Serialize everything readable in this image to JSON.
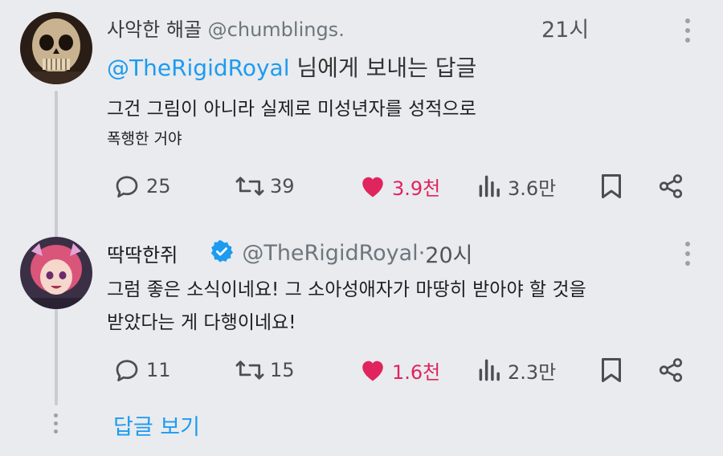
{
  "tweet1": {
    "display_name": "사악한 해골",
    "handle": "@chumblings.",
    "time": "21시",
    "reply_prefix": "@TheRigidRoyal",
    "reply_suffix": " 님에게 보내는 답글",
    "text_line1": "그건 그림이 아니라 실제로 미성년자를 성적으로",
    "text_line2": "폭행한 거야",
    "replies": "25",
    "retweets": "39",
    "likes": "3.9천",
    "views": "3.6만"
  },
  "tweet2": {
    "display_name": "딱딱한쥐",
    "handle": "@TheRigidRoyal",
    "separator": " · ",
    "time": "20시",
    "text_line1": "그럼 좋은 소식이네요! 그 소아성애자가 마땅히 받아야 할 것을",
    "text_line2": "받았다는 게 다행이네요!",
    "replies": "11",
    "retweets": "15",
    "likes": "1.6천",
    "views": "2.3만"
  },
  "show_replies_label": "답글 보기",
  "icons": {
    "reply": "reply-icon",
    "retweet": "retweet-icon",
    "like": "heart-icon",
    "views": "views-icon",
    "bookmark": "bookmark-icon",
    "share": "share-icon",
    "more": "more-icon",
    "verified": "verified-badge-icon"
  },
  "colors": {
    "accent": "#1d9bf0",
    "like": "#e0245e",
    "background": "#e9ebee"
  }
}
